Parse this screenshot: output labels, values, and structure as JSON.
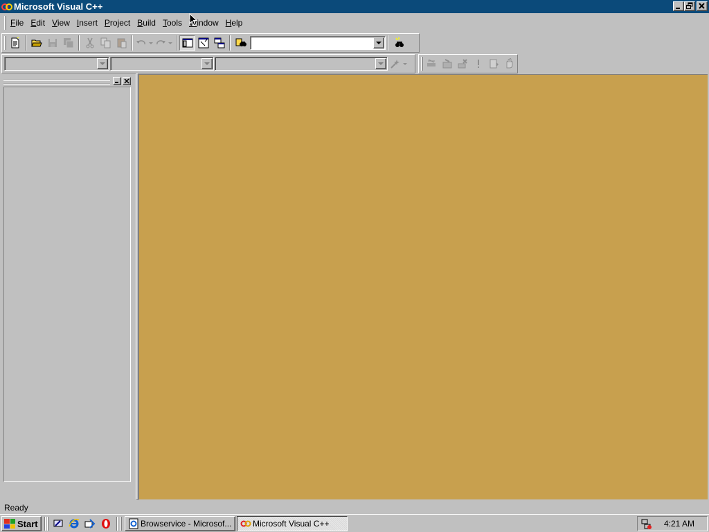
{
  "window": {
    "title": "Microsoft Visual C++",
    "caption_buttons": [
      "minimize-icon",
      "restore-icon",
      "close-icon"
    ]
  },
  "menu": {
    "items": [
      {
        "label": "File",
        "mnemonic": "F"
      },
      {
        "label": "Edit",
        "mnemonic": "E"
      },
      {
        "label": "View",
        "mnemonic": "V"
      },
      {
        "label": "Insert",
        "mnemonic": "I"
      },
      {
        "label": "Project",
        "mnemonic": "P"
      },
      {
        "label": "Build",
        "mnemonic": "B"
      },
      {
        "label": "Tools",
        "mnemonic": "T"
      },
      {
        "label": "Window",
        "mnemonic": "W"
      },
      {
        "label": "Help",
        "mnemonic": "H"
      }
    ]
  },
  "toolbar_standard": {
    "buttons": [
      "new-text-file-icon",
      "open-icon",
      "save-icon",
      "save-all-icon",
      "cut-icon",
      "copy-icon",
      "paste-icon",
      "undo-icon",
      "redo-icon",
      "workspace-icon",
      "output-icon",
      "window-list-icon",
      "find-in-files-icon",
      "find-icon"
    ],
    "find_combo_value": ""
  },
  "toolbar_wizard": {
    "class_combo_value": "",
    "member_combo_value": "",
    "function_combo_value": "",
    "wizard_action_icon": "magic-wand-icon"
  },
  "toolbar_build": {
    "buttons": [
      "compile-icon",
      "build-icon",
      "stop-build-icon",
      "execute-icon",
      "go-icon",
      "breakpoint-icon"
    ]
  },
  "workspace_pane": {
    "buttons": [
      "maximize-icon",
      "close-icon"
    ]
  },
  "colors": {
    "titlebar": "#0b4a7a",
    "mdi_background": "#c8a04e",
    "face": "#c0c0c0"
  },
  "statusbar": {
    "text": "Ready"
  },
  "taskbar": {
    "start_label": "Start",
    "quicklaunch": [
      "show-desktop-icon",
      "internet-explorer-icon",
      "outlook-express-icon",
      "opera-icon"
    ],
    "tasks": [
      {
        "label": "Browservice - Microsof...",
        "icon": "ie-document-icon",
        "active": false
      },
      {
        "label": "Microsoft Visual C++",
        "icon": "visual-cpp-icon",
        "active": true
      }
    ],
    "clock": "4:21 AM",
    "tray_icon": "network-icon"
  }
}
